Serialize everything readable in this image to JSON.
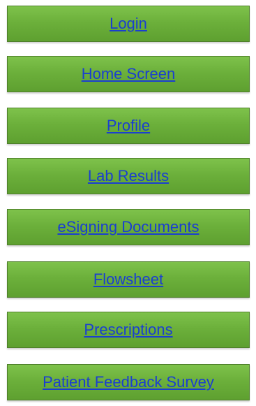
{
  "nav": {
    "items": [
      {
        "label": "Login"
      },
      {
        "label": "Home Screen"
      },
      {
        "label": "Profile"
      },
      {
        "label": "Lab Results"
      },
      {
        "label": "eSigning Documents"
      },
      {
        "label": "Flowsheet"
      },
      {
        "label": "Prescriptions"
      },
      {
        "label": "Patient Feedback Survey"
      }
    ]
  },
  "colors": {
    "button_fill": "#6cb03b",
    "button_border": "#4e7f2a",
    "link": "#1a3fd0"
  }
}
